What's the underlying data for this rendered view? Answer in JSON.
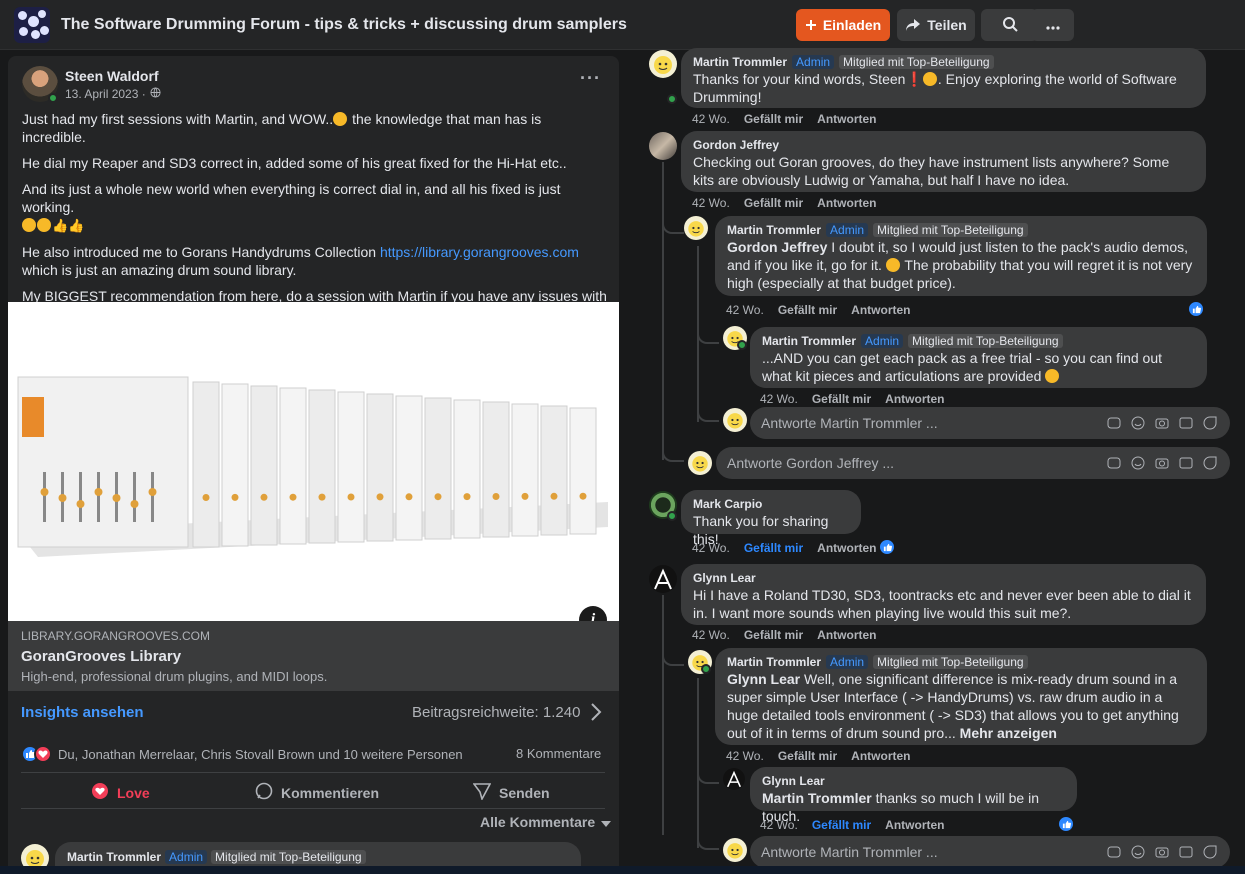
{
  "header": {
    "group_title": "The Software Drumming Forum - tips & tricks + discussing drum samplers",
    "invite_label": "Einladen",
    "share_label": "Teilen",
    "colors": {
      "accent": "#e4571f",
      "link": "#4599ff"
    }
  },
  "post": {
    "author": "Steen Waldorf",
    "date": "13. April 2023 ·",
    "body": {
      "p1": "Just had my first sessions with Martin, and WOW..",
      "p1b": " the knowledge that man has is incredible.",
      "p2": "He dial my Reaper and SD3 correct in, added some of his great fixed for the Hi-Hat etc..",
      "p3": "And its just a whole new world when everything is correct dial in, and all his fixed is just working.",
      "p4a": "He also introduced me to Gorans Handydrums Collection ",
      "p4link": "https://library.gorangrooves.com",
      "p4b": " which is just an amazing drum sound library.",
      "p5": "My BIGGEST recommendation from here, do a session with Martin if you have any issues with E-drumming."
    },
    "link_preview": {
      "domain": "LIBRARY.GORANGROOVES.COM",
      "title": "GoranGrooves Library",
      "description": "High-end, professional drum plugins, and MIDI loops."
    },
    "insights_label": "Insights ansehen",
    "reach_label": "Beitragsreichweite: 1.240",
    "reactions_text": "Du, Jonathan Merrelaar, Chris Stovall Brown und 10 weitere Personen",
    "comment_count": "8 Kommentare",
    "actions": {
      "love": "Love",
      "comment": "Kommentieren",
      "send": "Senden"
    },
    "sort_label": "Alle Kommentare",
    "bottom_comment": {
      "name": "Martin Trommler",
      "admin": "Admin",
      "badge": "Mitglied mit Top-Beteiligung"
    }
  },
  "comments": {
    "c1": {
      "name": "Martin Trommler",
      "admin": "Admin",
      "badge": "Mitglied mit Top-Beteiligung",
      "text1": "Thanks for your kind words, Steen",
      "text2": ". Enjoy exploring the world of Software Drumming!",
      "time": "42 Wo.",
      "like": "Gefällt mir",
      "reply": "Antworten"
    },
    "c2": {
      "name": "Gordon Jeffrey",
      "text": "Checking out Goran grooves, do they have instrument lists anywhere? Some kits are obviously Ludwig or Yamaha, but half I have no idea.",
      "time": "42 Wo.",
      "like": "Gefällt mir",
      "reply": "Antworten"
    },
    "c3": {
      "name": "Martin Trommler",
      "admin": "Admin",
      "badge": "Mitglied mit Top-Beteiligung",
      "mention": "Gordon Jeffrey",
      "text": " I doubt it, so I would just listen to the pack's audio demos, and if you like it, go for it.",
      "text2": " The probability that you will regret it is not very high (especially at that budget price).",
      "time": "42 Wo.",
      "like": "Gefällt mir",
      "reply": "Antworten"
    },
    "c4": {
      "name": "Martin Trommler",
      "admin": "Admin",
      "badge": "Mitglied mit Top-Beteiligung",
      "text": "...AND you can get each pack as a free trial - so you can find out what kit pieces and articulations are provided",
      "time": "42 Wo.",
      "like": "Gefällt mir",
      "reply": "Antworten"
    },
    "reply_martin_1": "Antworte Martin Trommler ...",
    "reply_gordon": "Antworte Gordon Jeffrey ...",
    "c5": {
      "name": "Mark Carpio",
      "text": "Thank you for sharing this!",
      "time": "42 Wo.",
      "like": "Gefällt mir",
      "reply": "Antworten"
    },
    "c6": {
      "name": "Glynn Lear",
      "text": "Hi I have a Roland TD30, SD3, toontracks etc and never ever been able to dial it in. I want more sounds when playing live would this suit me?.",
      "time": "42 Wo.",
      "like": "Gefällt mir",
      "reply": "Antworten"
    },
    "c7": {
      "name": "Martin Trommler",
      "admin": "Admin",
      "badge": "Mitglied mit Top-Beteiligung",
      "mention": "Glynn Lear",
      "text": " Well, one significant difference is mix-ready drum sound in a super simple User Interface ( -> HandyDrums) vs. raw drum audio in a huge detailed tools environment ( -> SD3) that allows you to get anything out of it in terms of drum sound pro...",
      "more": " Mehr anzeigen",
      "time": "42 Wo.",
      "like": "Gefällt mir",
      "reply": "Antworten"
    },
    "c8": {
      "name": "Glynn Lear",
      "mention": "Martin Trommler",
      "text": " thanks so much I will be in touch.",
      "time": "42 Wo.",
      "like": "Gefällt mir",
      "reply": "Antworten"
    },
    "reply_martin_2": "Antworte Martin Trommler ..."
  }
}
